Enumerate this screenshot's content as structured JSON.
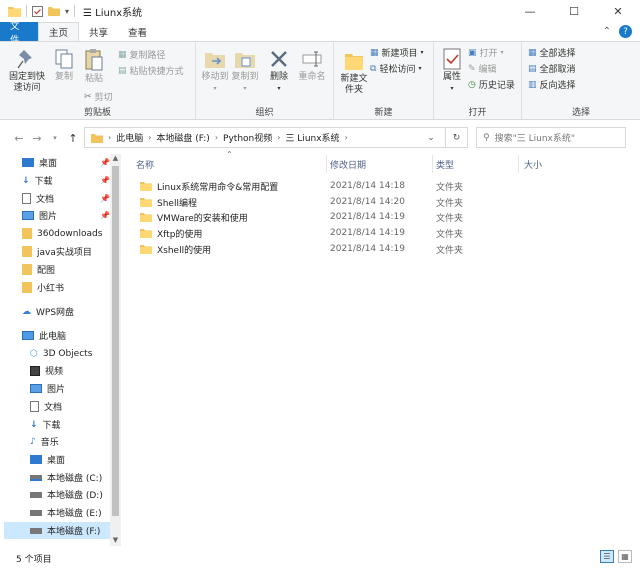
{
  "window": {
    "title": "Liunx系统",
    "title_prefix_icon": "folder-icon",
    "minimize": "—",
    "maximize": "☐",
    "close": "✕"
  },
  "tabs": [
    {
      "label": "文件"
    },
    {
      "label": "主页"
    },
    {
      "label": "共享"
    },
    {
      "label": "查看"
    }
  ],
  "ribbon": {
    "clipboard": {
      "label": "剪贴板",
      "pin": "固定到快速访问",
      "copy": "复制",
      "paste": "粘贴",
      "copy_path": "复制路径",
      "paste_shortcut": "粘贴快捷方式",
      "cut": "剪切"
    },
    "organize": {
      "label": "组织",
      "move_to": "移动到",
      "copy_to": "复制到",
      "delete": "删除",
      "rename": "重命名"
    },
    "new": {
      "label": "新建",
      "new_folder": "新建文件夹",
      "new_item": "新建项目",
      "easy_access": "轻松访问"
    },
    "open": {
      "label": "打开",
      "properties": "属性",
      "open": "打开",
      "edit": "编辑",
      "history": "历史记录"
    },
    "select": {
      "label": "选择",
      "select_all": "全部选择",
      "select_none": "全部取消",
      "invert": "反向选择"
    }
  },
  "address": {
    "crumbs": [
      "此电脑",
      "本地磁盘 (F:)",
      "Python视频",
      "三 Liunx系统"
    ],
    "search_placeholder": "搜索\"三 Liunx系统\""
  },
  "navpane": {
    "quick": [
      {
        "label": "桌面",
        "pinned": true
      },
      {
        "label": "下载",
        "pinned": true
      },
      {
        "label": "文档",
        "pinned": true
      },
      {
        "label": "图片",
        "pinned": true
      },
      {
        "label": "360downloads"
      },
      {
        "label": "java实战项目"
      },
      {
        "label": "配图"
      },
      {
        "label": "小红书"
      }
    ],
    "wps": "WPS网盘",
    "pc": "此电脑",
    "pc_items": [
      {
        "label": "3D Objects"
      },
      {
        "label": "视频"
      },
      {
        "label": "图片"
      },
      {
        "label": "文档"
      },
      {
        "label": "下载"
      },
      {
        "label": "音乐"
      },
      {
        "label": "桌面"
      },
      {
        "label": "本地磁盘 (C:)"
      },
      {
        "label": "本地磁盘 (D:)"
      },
      {
        "label": "本地磁盘 (E:)"
      },
      {
        "label": "本地磁盘 (F:)"
      }
    ]
  },
  "filelist": {
    "headers": {
      "name": "名称",
      "modified": "修改日期",
      "type": "类型",
      "size": "大小"
    },
    "rows": [
      {
        "name": "Linux系统常用命令&常用配置",
        "modified": "2021/8/14 14:18",
        "type": "文件夹"
      },
      {
        "name": "Shell编程",
        "modified": "2021/8/14 14:20",
        "type": "文件夹"
      },
      {
        "name": "VMWare的安装和使用",
        "modified": "2021/8/14 14:19",
        "type": "文件夹"
      },
      {
        "name": "Xftp的使用",
        "modified": "2021/8/14 14:19",
        "type": "文件夹"
      },
      {
        "name": "Xshell的使用",
        "modified": "2021/8/14 14:19",
        "type": "文件夹"
      }
    ]
  },
  "status": {
    "count": "5 个项目"
  },
  "colors": {
    "accent": "#1979ca",
    "folder": "#f2c55c",
    "selection": "#cce8ff"
  }
}
